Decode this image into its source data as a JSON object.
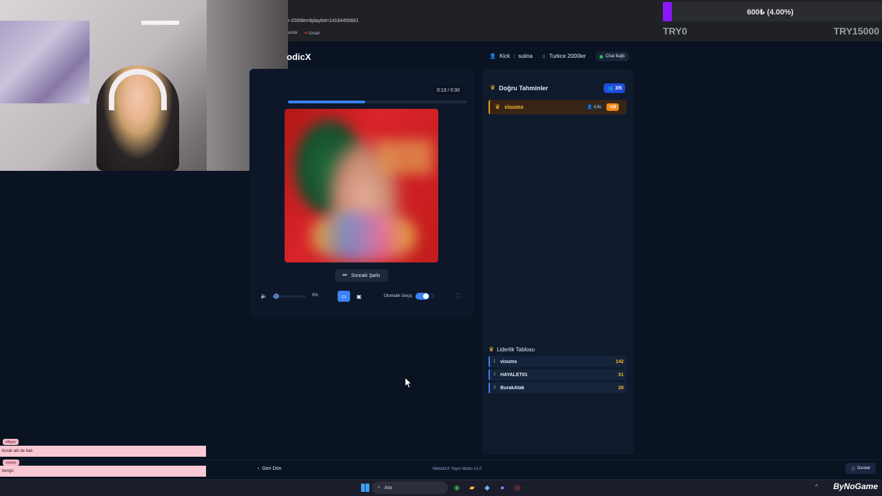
{
  "browser": {
    "url": "r-2000lerr8playlist=14164455661",
    "bookmarks": [
      "anda",
      "Gmail"
    ]
  },
  "donation": {
    "progress_text": "600₺ (4.00%)",
    "progress_fraction": 0.04,
    "min_label": "TRY0",
    "max_label": "TRY15000",
    "fill_color": "#8a17ff"
  },
  "app": {
    "logo": "odicX",
    "header": {
      "platform": "Kick",
      "channel": "sulina",
      "playlist": "Turkce 2000ler",
      "chat_status": "Chat Bağlı"
    },
    "player": {
      "time": "0:13 / 0:30",
      "progress_fraction": 0.43,
      "next_button": "Sonraki Şarkı",
      "volume": "9%",
      "volume_fraction": 0.09,
      "auto_label": "Otomatik Geçiş",
      "auto_enabled": true
    },
    "guesses": {
      "title": "Doğru Tahminler",
      "count": "3/5",
      "items": [
        {
          "name": "visums",
          "time": "4.8s",
          "points": "+29"
        }
      ]
    },
    "leaderboard": {
      "title": "Liderlik Tablosu",
      "rows": [
        {
          "rank": "1",
          "name": "visums",
          "score": "142"
        },
        {
          "rank": "2",
          "name": "HAYALET01",
          "score": "51"
        },
        {
          "rank": "3",
          "name": "BurakAtak",
          "score": "29"
        }
      ]
    },
    "footer": {
      "back": "Geri Dön",
      "version": "MelodicX Yayın Modu v1.0",
      "support": "Destek"
    }
  },
  "chat": [
    {
      "user": "ellaysc",
      "message": "burak abi de bak"
    },
    {
      "user": "visums",
      "message": "bengü"
    }
  ],
  "taskbar": {
    "search_placeholder": "Ara",
    "watermark": "ByNoGame"
  },
  "colors": {
    "accent": "#3b82f6",
    "gold": "#f5b82e",
    "background": "#0a1322"
  }
}
